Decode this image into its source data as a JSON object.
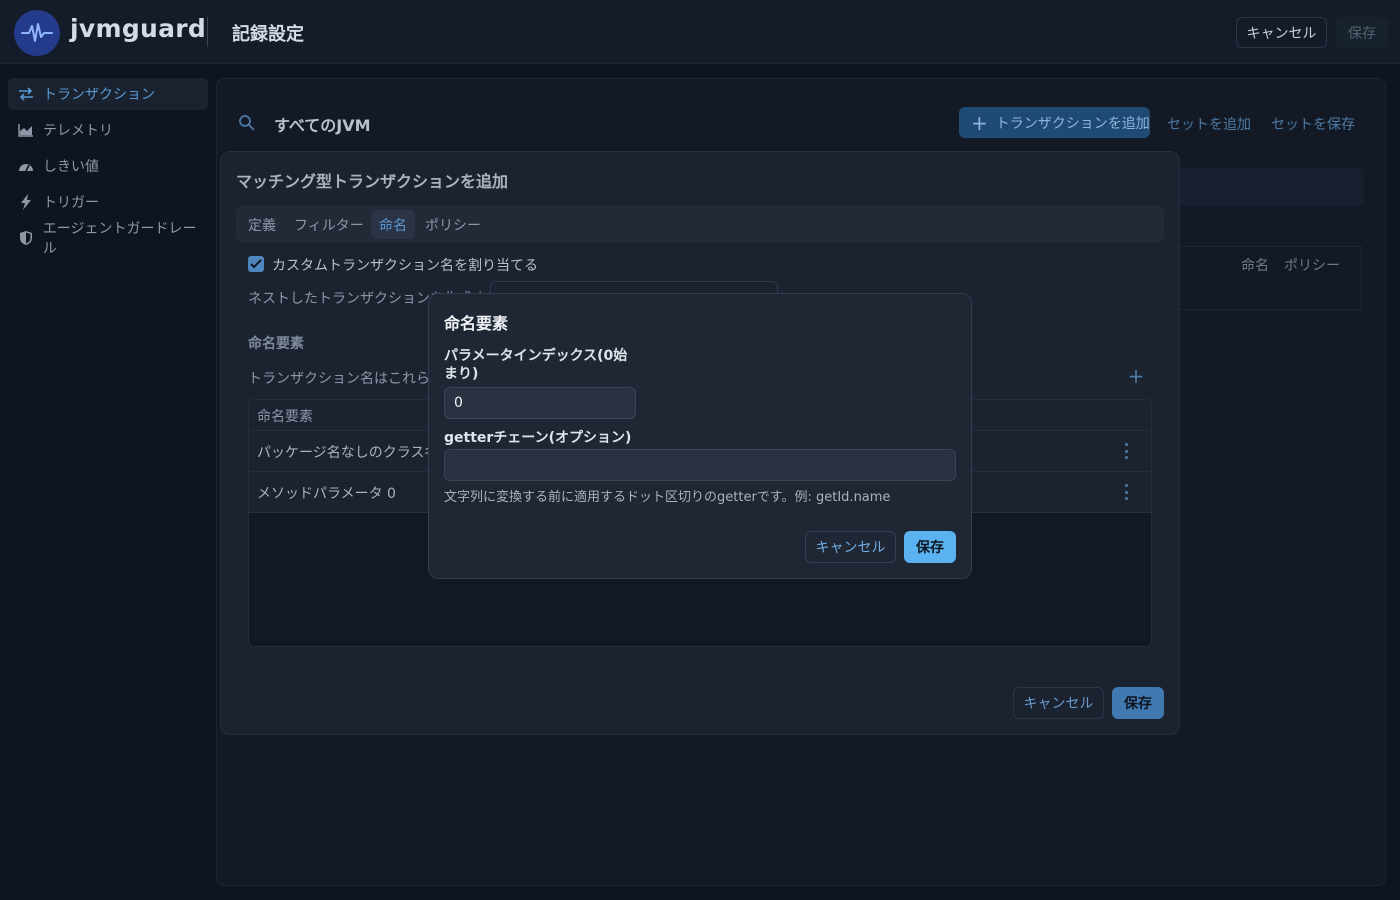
{
  "header": {
    "brand": "jvmguard",
    "title": "記録設定",
    "cancel_label": "キャンセル",
    "save_label": "保存"
  },
  "sidebar": {
    "items": [
      {
        "label": "トランザクション",
        "icon": "transactions-icon",
        "active": true
      },
      {
        "label": "テレメトリ",
        "icon": "telemetry-chart-icon",
        "active": false
      },
      {
        "label": "しきい値",
        "icon": "gauge-icon",
        "active": false
      },
      {
        "label": "トリガー",
        "icon": "lightning-icon",
        "active": false
      },
      {
        "label": "エージェントガードレール",
        "icon": "shield-icon",
        "active": false
      }
    ]
  },
  "main": {
    "jvm_selector": "すべてのJVM",
    "add_transaction_label": "トランザクションを追加",
    "add_set_label": "セットを追加",
    "save_set_label": "セットを保存",
    "columns": {
      "naming": "命名",
      "policy": "ポリシー"
    }
  },
  "transaction_dialog": {
    "title": "マッチング型トランザクションを追加",
    "tabs": [
      "定義",
      "フィルター",
      "命名",
      "ポリシー"
    ],
    "active_tab": "命名",
    "custom_name_checkbox": {
      "label": "カスタムトランザクション名を割り当てる",
      "checked": true
    },
    "nested_label": "ネストしたトランザクションを作成する",
    "section_title": "命名要素",
    "section_description": "トランザクション名はこれらの命名要素から作成されます",
    "table": {
      "header": "命名要素",
      "rows": [
        "パッケージ名なしのクラス名",
        "メソッドパラメータ 0"
      ]
    },
    "cancel_label": "キャンセル",
    "save_label": "保存"
  },
  "naming_element_dialog": {
    "title": "命名要素",
    "param_index_label": "パラメータインデックス(0始まり)",
    "param_index_value": "0",
    "getter_chain_label": "getterチェーン(オプション)",
    "getter_chain_value": "",
    "help_text": "文字列に変換する前に適用するドット区切りのgetterです。例: getId.name",
    "cancel_label": "キャンセル",
    "save_label": "保存"
  },
  "colors": {
    "accent": "#5ab2f0",
    "background": "#0f1520",
    "dialog": "#1f2634"
  }
}
